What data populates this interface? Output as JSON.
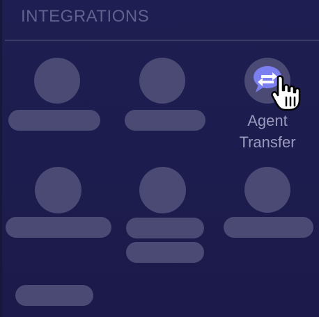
{
  "section": {
    "title": "INTEGRATIONS"
  },
  "integrations": {
    "agent_transfer": {
      "line1": "Agent",
      "line2": "Transfer",
      "icon": "chat-transfer-icon"
    }
  },
  "cursor": {
    "icon": "hand-pointer-icon"
  },
  "colors": {
    "background": "#1c1c4c",
    "placeholder": "#4a4a74",
    "accent_icon": "#7b7ff0",
    "label": "#9a9abc",
    "title": "#62628f"
  }
}
